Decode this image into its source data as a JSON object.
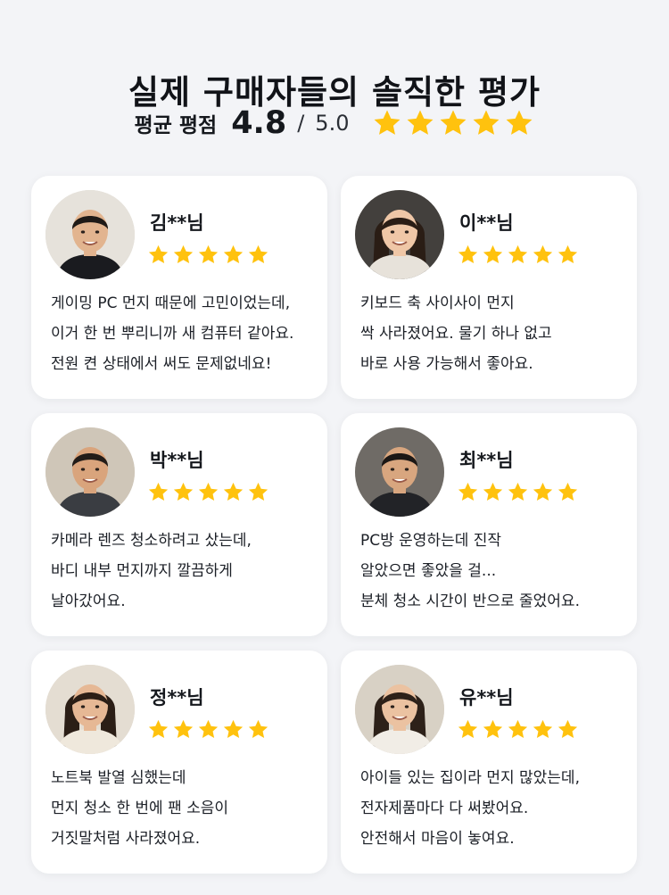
{
  "header": {
    "title": "실제 구매자들의 솔직한 평가",
    "average_label": "평균 평점",
    "average_value": "4.8",
    "average_separator": "/",
    "average_max": "5.0",
    "star_count": 5
  },
  "colors": {
    "background": "#f3f4f7",
    "card": "#ffffff",
    "star": "#ffc20e",
    "text": "#15181d"
  },
  "icons": {
    "rating_star": "star-icon",
    "reviewer_photo": "avatar-icon"
  },
  "reviews": [
    {
      "name": "김**님",
      "stars": 5,
      "lines": [
        "게이밍 PC 먼지 때문에 고민이었는데,",
        "이거 한 번 뿌리니까 새 컴퓨터 같아요.",
        "전원 켠 상태에서 써도 문제없네요!"
      ]
    },
    {
      "name": "이**님",
      "stars": 5,
      "lines": [
        "키보드 축 사이사이 먼지",
        "싹 사라졌어요. 물기 하나 없고",
        "바로 사용 가능해서 좋아요."
      ]
    },
    {
      "name": "박**님",
      "stars": 5,
      "lines": [
        "카메라 렌즈 청소하려고 샀는데,",
        "바디 내부 먼지까지 깔끔하게",
        "날아갔어요."
      ]
    },
    {
      "name": "최**님",
      "stars": 5,
      "lines": [
        "PC방 운영하는데 진작",
        "알았으면 좋았을 걸...",
        "분체 청소 시간이 반으로 줄었어요."
      ]
    },
    {
      "name": "정**님",
      "stars": 5,
      "lines": [
        "노트북 발열 심했는데",
        "먼지 청소 한 번에 팬 소음이",
        "거짓말처럼 사라졌어요."
      ]
    },
    {
      "name": "유**님",
      "stars": 5,
      "lines": [
        "아이들 있는 집이라 먼지 많았는데,",
        "전자제품마다 다 써봤어요.",
        "안전해서 마음이 놓여요."
      ]
    }
  ]
}
